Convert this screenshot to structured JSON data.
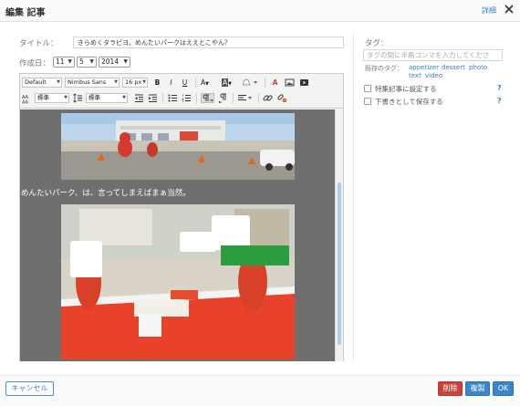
{
  "dialog": {
    "title": "編集 記事",
    "detail_link": "詳細"
  },
  "form": {
    "title_label": "タイトル：",
    "title_value": "きらめくタラピヨ。めんたいパークはええとこやん？",
    "date_label": "作成日：",
    "date_day": "11",
    "date_month": "5",
    "date_year": "2014"
  },
  "toolbar": {
    "format": "Default",
    "font": "Nimbus Sans",
    "size": "16 px",
    "bold": "B",
    "italic": "I",
    "underline": "U",
    "font_color": "A",
    "highlight": "A",
    "clear_format": "A",
    "line_size": "標準",
    "line_height": "標準"
  },
  "content": {
    "body_text": "めんたいパーク、は、言ってしまえばまぁ当然。"
  },
  "sidebar": {
    "tag_label": "タグ：",
    "tag_placeholder": "タグの間に半角コンマを入力してくださ",
    "existing_tags_label": "既存のタグ：",
    "tags": [
      "appetizer",
      "dessert",
      "photo",
      "text",
      "video"
    ],
    "featured_label": "特集記事に設定する",
    "draft_label": "下書きとして保存する",
    "help_mark": "?"
  },
  "footer": {
    "cancel": "キャンセル",
    "delete": "削除",
    "duplicate": "複製",
    "ok": "OK"
  },
  "colors": {
    "accent": "#3a86c8",
    "danger": "#c9433a",
    "link": "#3b7fc4",
    "scroll_thumb": "#a8d0ef"
  }
}
